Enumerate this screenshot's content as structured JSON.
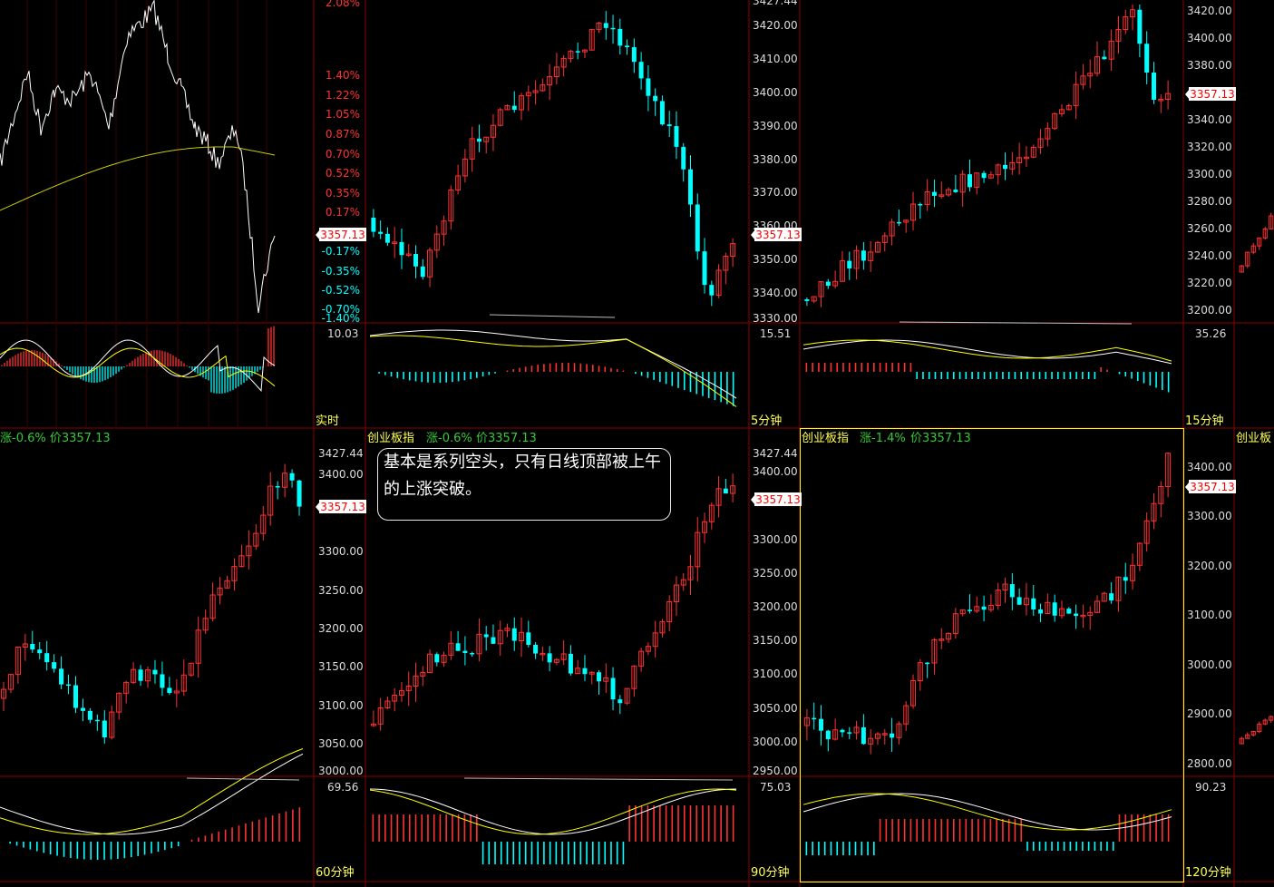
{
  "colors": {
    "up": "#ff3232",
    "down": "#00ffff",
    "grid": "#8a0000",
    "price_red": "#ff3232",
    "price_cyan": "#00ffff",
    "axis_text": "#dddddd",
    "title_green": "#33cc33",
    "title_yellow": "#ffff55",
    "active_border": "#ffff00",
    "price_tag": "#ff0000"
  },
  "current_price": "3357.13",
  "note_text": "基本是系列空头，只有日线顶部被上午 的上涨突破。",
  "panels": [
    {
      "id": "intraday",
      "period": "实时",
      "title": "",
      "pct_axis_pos": [
        "2.08%",
        "1.40%",
        "1.22%",
        "1.05%",
        "0.87%",
        "0.70%",
        "0.52%",
        "0.35%",
        "0.17%"
      ],
      "pct_axis_neg": [
        "-0.17%",
        "-0.35%",
        "-0.52%",
        "-0.70%",
        "-1.40%"
      ],
      "macd_top": "10.03"
    },
    {
      "id": "m5",
      "period": "5分钟",
      "title": "",
      "price_axis": [
        "3427.44",
        "3420.00",
        "3410.00",
        "3400.00",
        "3390.00",
        "3380.00",
        "3370.00",
        "3360.00",
        "3350.00",
        "3340.00",
        "3330.00"
      ],
      "macd_top": "15.51"
    },
    {
      "id": "m15",
      "period": "15分钟",
      "title": "",
      "price_axis": [
        "3420.00",
        "3400.00",
        "3380.00",
        "3340.00",
        "3320.00",
        "3300.00",
        "3280.00",
        "3260.00",
        "3240.00",
        "3220.00",
        "3200.00"
      ],
      "macd_top": "35.26"
    },
    {
      "id": "m60",
      "period": "60分钟",
      "title": "涨-0.6% 价3357.13",
      "price_axis": [
        "3427.44",
        "3400.00",
        "3300.00",
        "3250.00",
        "3200.00",
        "3150.00",
        "3100.00",
        "3050.00",
        "3000.00"
      ],
      "macd_top": "69.56"
    },
    {
      "id": "m90",
      "period": "90分钟",
      "title": "创业板指",
      "title_change": "涨-0.6%",
      "title_price": "价3357.13",
      "price_axis": [
        "3427.44",
        "3400.00",
        "3300.00",
        "3250.00",
        "3200.00",
        "3150.00",
        "3100.00",
        "3050.00",
        "3000.00",
        "2950.00"
      ],
      "macd_top": "75.03"
    },
    {
      "id": "m120",
      "period": "120分钟",
      "title": "创业板指",
      "title_change": "涨-1.4%",
      "title_price": "价3357.13",
      "price_axis": [
        "3400.00",
        "3300.00",
        "3200.00",
        "3100.00",
        "3000.00",
        "2900.00",
        "2800.00"
      ],
      "macd_top": "90.23"
    },
    {
      "id": "edge",
      "period": "",
      "title": "创业板"
    }
  ]
}
